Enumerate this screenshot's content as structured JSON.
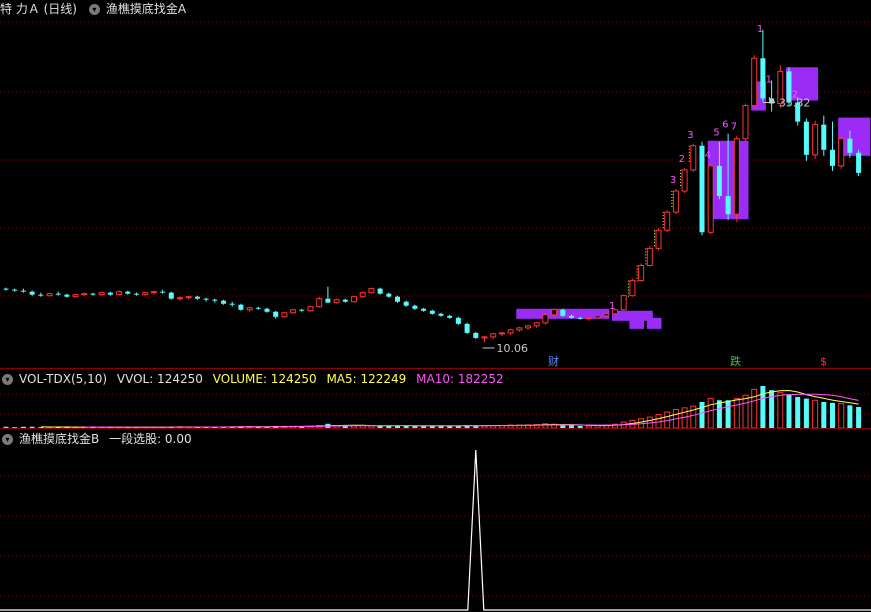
{
  "main": {
    "stock_label": "特 力Ａ (日线)",
    "indicator_label": "渔樵摸底找金A",
    "price_high": "35.32",
    "price_low": "10.06",
    "tag_cai": "财",
    "tag_die": "跌",
    "tag_s": "$",
    "signals": [
      "1",
      "1",
      "2",
      "3",
      "3",
      "4",
      "5",
      "6",
      "7",
      "1",
      "2"
    ]
  },
  "volume": {
    "title": "VOL-TDX(5,10)",
    "vvol": "VVOL: 124250",
    "volume": "VOLUME: 124250",
    "ma5": "MA5: 122249",
    "ma10": "MA10: 182252"
  },
  "indicator": {
    "title": "渔樵摸底找金B",
    "field": "一段选股: 0.00"
  },
  "colors": {
    "up": "#ff3232",
    "down": "#54fcfc",
    "purple": "#9b2cf5",
    "grid": "#8a0000",
    "yellow": "#ffff54",
    "magenta": "#ff54ff"
  },
  "candles": [
    [
      9.6,
      9.7,
      9.4,
      9.5
    ],
    [
      9.5,
      9.6,
      9.3,
      9.4
    ],
    [
      9.4,
      9.6,
      9.2,
      9.3
    ],
    [
      9.3,
      9.4,
      8.9,
      9.0
    ],
    [
      9.0,
      9.2,
      8.8,
      8.9
    ],
    [
      8.9,
      9.2,
      8.8,
      9.1
    ],
    [
      9.1,
      9.3,
      8.9,
      9.0
    ],
    [
      9.0,
      9.1,
      8.7,
      8.8
    ],
    [
      8.8,
      9.1,
      8.7,
      9.0
    ],
    [
      9.0,
      9.2,
      8.9,
      9.1
    ],
    [
      9.1,
      9.2,
      8.9,
      9.0
    ],
    [
      9.0,
      9.3,
      8.9,
      9.2
    ],
    [
      9.2,
      9.3,
      8.9,
      9.0
    ],
    [
      9.0,
      9.4,
      8.9,
      9.3
    ],
    [
      9.3,
      9.4,
      9.0,
      9.1
    ],
    [
      9.1,
      9.2,
      8.9,
      9.0
    ],
    [
      9.0,
      9.3,
      8.9,
      9.2
    ],
    [
      9.2,
      9.4,
      9.0,
      9.3
    ],
    [
      9.3,
      9.5,
      9.1,
      9.2
    ],
    [
      9.2,
      9.3,
      8.5,
      8.6
    ],
    [
      8.6,
      8.8,
      8.4,
      8.7
    ],
    [
      8.7,
      8.9,
      8.5,
      8.8
    ],
    [
      8.8,
      8.9,
      8.5,
      8.6
    ],
    [
      8.6,
      8.7,
      8.3,
      8.5
    ],
    [
      8.5,
      8.6,
      8.2,
      8.4
    ],
    [
      8.4,
      8.5,
      8.0,
      8.1
    ],
    [
      8.1,
      8.3,
      7.8,
      8.0
    ],
    [
      8.0,
      8.1,
      7.4,
      7.5
    ],
    [
      7.5,
      7.8,
      7.3,
      7.7
    ],
    [
      7.7,
      7.8,
      7.5,
      7.6
    ],
    [
      7.6,
      7.7,
      7.2,
      7.3
    ],
    [
      7.3,
      7.4,
      6.6,
      6.8
    ],
    [
      6.8,
      7.3,
      6.7,
      7.2
    ],
    [
      7.2,
      7.6,
      7.1,
      7.5
    ],
    [
      7.5,
      7.6,
      7.3,
      7.4
    ],
    [
      7.4,
      7.9,
      7.3,
      7.8
    ],
    [
      7.8,
      8.8,
      7.7,
      8.6
    ],
    [
      8.6,
      9.8,
      8.5,
      8.2
    ],
    [
      8.2,
      8.6,
      8.1,
      8.5
    ],
    [
      8.5,
      8.6,
      8.2,
      8.3
    ],
    [
      8.3,
      8.9,
      8.2,
      8.8
    ],
    [
      8.8,
      9.3,
      8.7,
      9.2
    ],
    [
      9.2,
      9.7,
      9.1,
      9.6
    ],
    [
      9.6,
      9.7,
      9.0,
      9.1
    ],
    [
      9.1,
      9.2,
      8.7,
      8.8
    ],
    [
      8.8,
      8.9,
      8.2,
      8.3
    ],
    [
      8.3,
      8.4,
      7.8,
      7.9
    ],
    [
      7.9,
      8.0,
      7.5,
      7.6
    ],
    [
      7.6,
      7.7,
      7.3,
      7.4
    ],
    [
      7.4,
      7.5,
      7.0,
      7.1
    ],
    [
      7.1,
      7.2,
      6.8,
      6.9
    ],
    [
      6.9,
      7.0,
      6.6,
      6.7
    ],
    [
      6.7,
      6.8,
      6.0,
      6.1
    ],
    [
      6.1,
      6.2,
      5.1,
      5.2
    ],
    [
      5.2,
      5.3,
      4.6,
      4.7
    ],
    [
      4.7,
      4.9,
      4.3,
      4.8
    ],
    [
      4.8,
      5.2,
      4.6,
      5.1
    ],
    [
      5.1,
      5.3,
      4.9,
      5.2
    ],
    [
      5.2,
      5.6,
      5.0,
      5.5
    ],
    [
      5.5,
      5.8,
      5.3,
      5.7
    ],
    [
      5.7,
      6.0,
      5.5,
      5.9
    ],
    [
      5.9,
      6.3,
      5.7,
      6.2
    ],
    [
      6.2,
      7.2,
      6.0,
      7.0
    ],
    [
      7.0,
      7.6,
      6.9,
      7.5
    ],
    [
      7.5,
      7.6,
      6.8,
      6.9
    ],
    [
      6.9,
      7.0,
      6.6,
      6.7
    ],
    [
      6.7,
      6.8,
      6.5,
      6.6
    ],
    [
      6.6,
      6.8,
      6.4,
      6.7
    ],
    [
      6.7,
      7.0,
      6.6,
      6.9
    ],
    [
      6.9,
      7.2,
      6.8,
      7.1
    ],
    [
      7.1,
      7.6,
      7.0,
      7.5
    ],
    [
      7.5,
      9.0,
      7.4,
      8.9
    ],
    [
      8.9,
      10.6,
      8.8,
      10.4
    ],
    [
      10.4,
      12.1,
      10.3,
      11.9
    ],
    [
      11.9,
      13.8,
      11.8,
      13.6
    ],
    [
      13.6,
      15.6,
      13.4,
      15.4
    ],
    [
      15.4,
      17.4,
      15.2,
      17.2
    ],
    [
      17.2,
      19.5,
      17.0,
      19.3
    ],
    [
      19.3,
      21.6,
      19.1,
      21.4
    ],
    [
      21.4,
      24.0,
      21.2,
      23.8
    ],
    [
      23.8,
      24.2,
      14.9,
      15.2
    ],
    [
      15.2,
      22.0,
      15.0,
      21.8
    ],
    [
      21.8,
      24.2,
      18.5,
      18.8
    ],
    [
      18.8,
      25.0,
      16.4,
      17.0
    ],
    [
      17.0,
      24.8,
      16.2,
      24.5
    ],
    [
      24.5,
      28.0,
      24.2,
      27.8
    ],
    [
      27.8,
      32.8,
      27.5,
      32.5
    ],
    [
      32.5,
      35.32,
      28.2,
      28.5
    ],
    [
      28.5,
      30.3,
      27.2,
      28.0
    ],
    [
      28.0,
      31.8,
      27.6,
      31.2
    ],
    [
      31.2,
      31.6,
      27.8,
      28.1
    ],
    [
      28.1,
      28.6,
      25.8,
      26.2
    ],
    [
      26.2,
      26.5,
      22.3,
      22.9
    ],
    [
      22.9,
      26.3,
      22.5,
      25.9
    ],
    [
      25.9,
      26.8,
      22.8,
      23.4
    ],
    [
      23.4,
      26.2,
      21.3,
      21.8
    ],
    [
      21.8,
      24.8,
      21.5,
      24.5
    ],
    [
      24.5,
      25.3,
      22.6,
      23.1
    ],
    [
      23.1,
      23.4,
      20.8,
      21.1
    ]
  ],
  "volumes": [
    3,
    2,
    3,
    3,
    2,
    2,
    2,
    3,
    2,
    2,
    2,
    2,
    2,
    2,
    2,
    2,
    2,
    2,
    2,
    3,
    3,
    2,
    2,
    2,
    3,
    3,
    3,
    4,
    3,
    2,
    3,
    5,
    4,
    4,
    3,
    4,
    6,
    10,
    6,
    5,
    5,
    6,
    6,
    5,
    5,
    6,
    6,
    5,
    5,
    5,
    5,
    5,
    6,
    7,
    6,
    5,
    6,
    6,
    7,
    7,
    7,
    8,
    10,
    9,
    7,
    6,
    5,
    5,
    6,
    7,
    9,
    14,
    18,
    22,
    26,
    32,
    38,
    44,
    48,
    52,
    62,
    70,
    66,
    66,
    70,
    78,
    92,
    100,
    90,
    84,
    80,
    74,
    70,
    66,
    62,
    60,
    58,
    54,
    50
  ],
  "indicator_spike": {
    "index": 54,
    "value": 1
  }
}
